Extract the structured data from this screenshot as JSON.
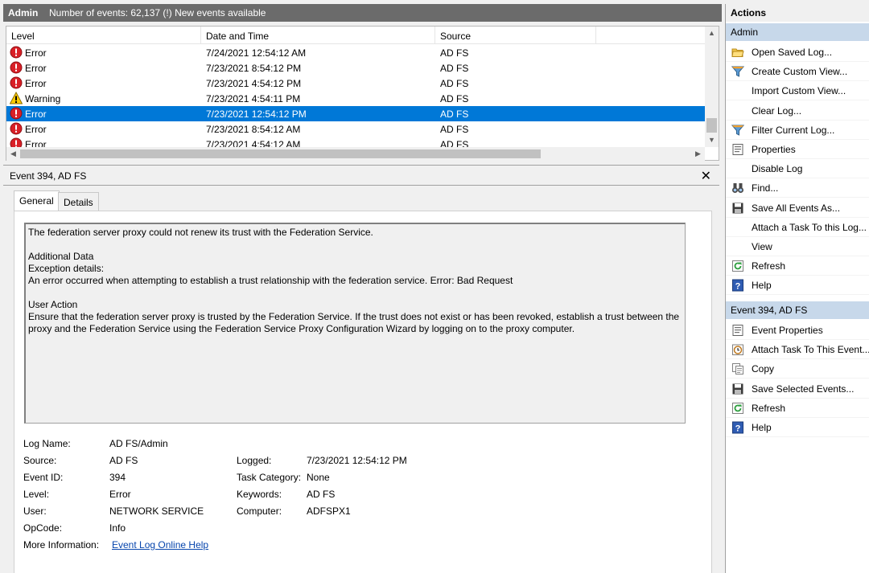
{
  "title_bar": {
    "name": "Admin",
    "info": "Number of events: 62,137 (!) New events available"
  },
  "event_list": {
    "columns": [
      "Level",
      "Date and Time",
      "Source"
    ],
    "rows": [
      {
        "level": "Error",
        "datetime": "7/24/2021 12:54:12 AM",
        "source": "AD FS",
        "icon": "error-icon"
      },
      {
        "level": "Error",
        "datetime": "7/23/2021 8:54:12 PM",
        "source": "AD FS",
        "icon": "error-icon"
      },
      {
        "level": "Error",
        "datetime": "7/23/2021 4:54:12 PM",
        "source": "AD FS",
        "icon": "error-icon"
      },
      {
        "level": "Warning",
        "datetime": "7/23/2021 4:54:11 PM",
        "source": "AD FS",
        "icon": "warning-icon"
      },
      {
        "level": "Error",
        "datetime": "7/23/2021 12:54:12 PM",
        "source": "AD FS",
        "icon": "error-icon",
        "selected": true
      },
      {
        "level": "Error",
        "datetime": "7/23/2021 8:54:12 AM",
        "source": "AD FS",
        "icon": "error-icon"
      },
      {
        "level": "Error",
        "datetime": "7/23/2021 4:54:12 AM",
        "source": "AD FS",
        "icon": "error-icon"
      }
    ]
  },
  "detail": {
    "title": "Event 394, AD FS",
    "tabs": [
      "General",
      "Details"
    ],
    "description": {
      "line1": "The federation server proxy could not renew its trust with the Federation Service.",
      "line2": "Additional Data",
      "line3": "Exception details:",
      "line4": "An error occurred when attempting to establish a trust relationship with the federation service. Error: Bad Request",
      "line5": "User Action",
      "line6": "Ensure that the federation server proxy is trusted by the Federation Service. If the trust does not exist or has been revoked, establish a trust between the",
      "line7": "proxy and the Federation Service using the Federation Service Proxy Configuration Wizard by logging on to the proxy computer."
    },
    "fields": {
      "log_name_label": "Log Name:",
      "log_name": "AD FS/Admin",
      "source_label": "Source:",
      "source": "AD FS",
      "logged_label": "Logged:",
      "logged": "7/23/2021 12:54:12 PM",
      "event_id_label": "Event ID:",
      "event_id": "394",
      "task_category_label": "Task Category:",
      "task_category": "None",
      "level_label": "Level:",
      "level": "Error",
      "keywords_label": "Keywords:",
      "keywords": "AD FS",
      "user_label": "User:",
      "user": "NETWORK SERVICE",
      "computer_label": "Computer:",
      "computer": "ADFSPX1",
      "opcode_label": "OpCode:",
      "opcode": "Info",
      "more_info_label": "More Information:",
      "more_info_link": "Event Log Online Help"
    }
  },
  "actions": {
    "header": "Actions",
    "section1": "Admin",
    "section1_items": [
      {
        "label": "Open Saved Log...",
        "icon": "folder-icon"
      },
      {
        "label": "Create Custom View...",
        "icon": "filter-icon"
      },
      {
        "label": "Import Custom View...",
        "icon": ""
      },
      {
        "label": "Clear Log...",
        "icon": ""
      },
      {
        "label": "Filter Current Log...",
        "icon": "filter-icon"
      },
      {
        "label": "Properties",
        "icon": "properties-icon"
      },
      {
        "label": "Disable Log",
        "icon": ""
      },
      {
        "label": "Find...",
        "icon": "binoculars-icon"
      },
      {
        "label": "Save All Events As...",
        "icon": "save-icon"
      },
      {
        "label": "Attach a Task To this Log...",
        "icon": ""
      },
      {
        "label": "View",
        "icon": ""
      },
      {
        "label": "Refresh",
        "icon": "refresh-icon"
      },
      {
        "label": "Help",
        "icon": "help-icon"
      }
    ],
    "section2": "Event 394, AD FS",
    "section2_items": [
      {
        "label": "Event Properties",
        "icon": "properties-icon"
      },
      {
        "label": "Attach Task To This Event...",
        "icon": "clock-icon"
      },
      {
        "label": "Copy",
        "icon": "copy-icon"
      },
      {
        "label": "Save Selected Events...",
        "icon": "save-icon"
      },
      {
        "label": "Refresh",
        "icon": "refresh-icon"
      },
      {
        "label": "Help",
        "icon": "help-icon"
      }
    ]
  }
}
